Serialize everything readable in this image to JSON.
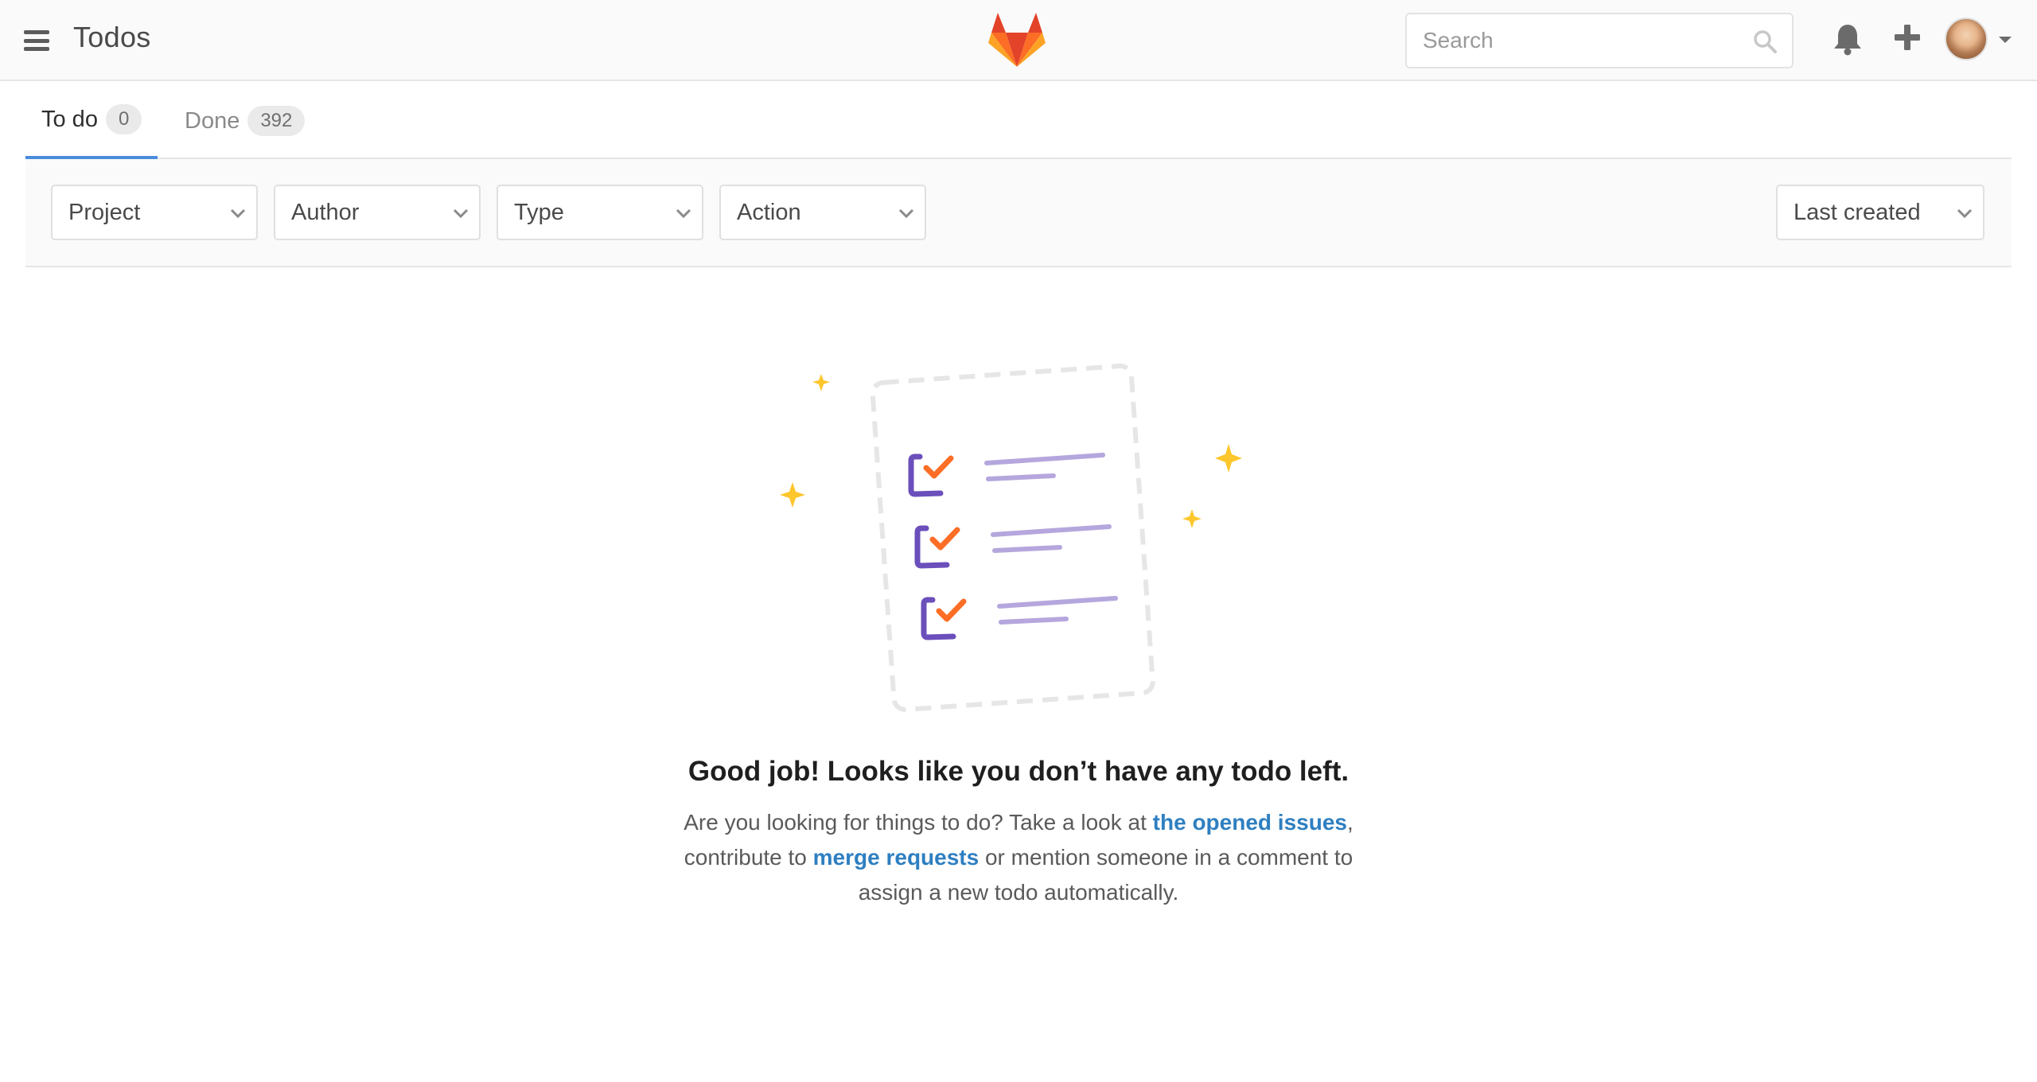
{
  "header": {
    "title": "Todos",
    "search_placeholder": "Search"
  },
  "tabs": [
    {
      "label": "To do",
      "count": "0",
      "active": true
    },
    {
      "label": "Done",
      "count": "392",
      "active": false
    }
  ],
  "filters": {
    "project": "Project",
    "author": "Author",
    "type": "Type",
    "action": "Action",
    "sort": "Last created"
  },
  "empty_state": {
    "title": "Good job! Looks like you don’t have any todo left.",
    "text_1": "Are you looking for things to do? Take a look at ",
    "link_issues": "the opened issues",
    "text_2": ", contribute to ",
    "link_mrs": "merge requests",
    "text_3": " or mention someone in a comment to assign a new todo automatically."
  },
  "colors": {
    "accent": "#4a8bdb",
    "link": "#2e7fc1",
    "check_purple": "#6b4fbb",
    "check_orange": "#fc6d26",
    "line_lavender": "#b5a7dd",
    "sparkle": "#fdc62c"
  },
  "icons": [
    "hamburger-icon",
    "gitlab-logo-icon",
    "search-icon",
    "bell-icon",
    "plus-icon",
    "chevron-down-icon"
  ]
}
